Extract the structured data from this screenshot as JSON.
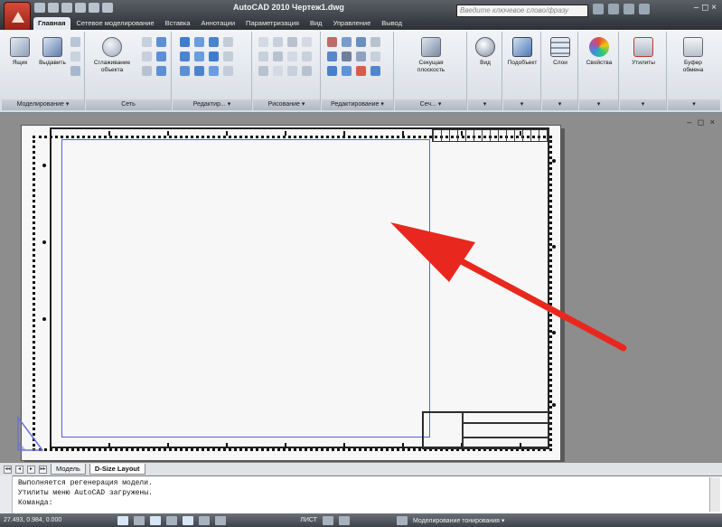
{
  "title_bar": {
    "title": "AutoCAD 2010   Чертеж1.dwg",
    "search_placeholder": "Введите ключевое слово/фразу",
    "window_controls": "– ◻ ×"
  },
  "ribbon_tabs": [
    {
      "label": "Главная",
      "active": true
    },
    {
      "label": "Сетевое моделирование",
      "active": false
    },
    {
      "label": "Вставка",
      "active": false
    },
    {
      "label": "Аннотации",
      "active": false
    },
    {
      "label": "Параметризация",
      "active": false
    },
    {
      "label": "Вид",
      "active": false
    },
    {
      "label": "Управление",
      "active": false
    },
    {
      "label": "Вывод",
      "active": false
    }
  ],
  "ribbon": {
    "tools": {
      "box": "Ящик",
      "extrude": "Выдавить",
      "smooth_object": "Сглаживание объекта",
      "section_plane": "Секущая плоскость",
      "view": "Вид",
      "subobject": "Подобъект",
      "layers": "Слои",
      "properties": "Свойства",
      "utilities": "Утилиты",
      "clipboard": "Буфер обмена"
    },
    "panels": {
      "modeling": "Моделирование ▾",
      "mesh": "Сеть",
      "edit": "Редактир... ▾",
      "draw": "Рисование ▾",
      "modify": "Редактирование ▾",
      "section": "Сеч... ▾"
    }
  },
  "canvas": {
    "view_controls": "– ◻ ×"
  },
  "layout_tabs": {
    "nav": [
      "◂◂",
      "◂",
      "▸",
      "▸▸"
    ],
    "tabs": [
      {
        "label": "Модель",
        "active": false
      },
      {
        "label": "D-Size Layout",
        "active": true
      }
    ]
  },
  "command_window": {
    "lines": [
      "Выполняется регенерация модели.",
      "Утилиты меню AutoCAD загружены."
    ],
    "prompt": "Команда:"
  },
  "status_bar": {
    "coordinates": "27.493, 0.984, 0.000",
    "space_label": "ЛИСТ",
    "workspace": "Моделирование тонирования ▾"
  },
  "colors": {
    "viewport_border": "#5563d8",
    "arrow": "#e8281e",
    "app_button": "#c8392b"
  }
}
